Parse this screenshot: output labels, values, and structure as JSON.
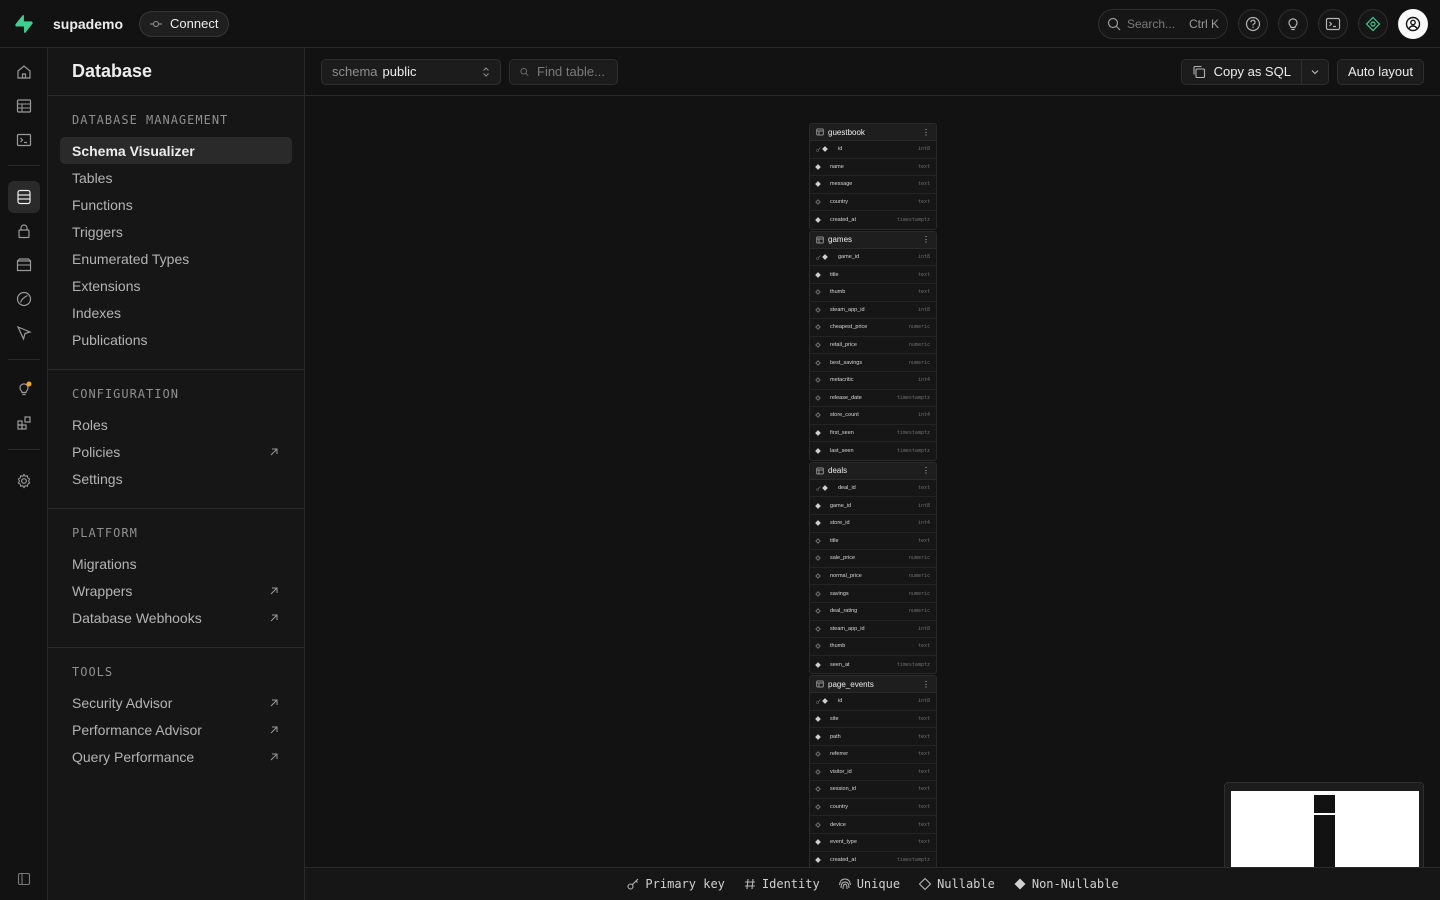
{
  "project": {
    "name": "supademo",
    "connect_label": "Connect"
  },
  "search": {
    "placeholder": "Search...",
    "shortcut": "Ctrl K"
  },
  "sidebar": {
    "title": "Database",
    "sections": [
      {
        "title": "DATABASE MANAGEMENT",
        "items": [
          "Schema Visualizer",
          "Tables",
          "Functions",
          "Triggers",
          "Enumerated Types",
          "Extensions",
          "Indexes",
          "Publications"
        ]
      },
      {
        "title": "CONFIGURATION",
        "items": [
          "Roles",
          "Policies",
          "Settings"
        ]
      },
      {
        "title": "PLATFORM",
        "items": [
          "Migrations",
          "Wrappers",
          "Database Webhooks"
        ]
      },
      {
        "title": "TOOLS",
        "items": [
          "Security Advisor",
          "Performance Advisor",
          "Query Performance"
        ]
      }
    ]
  },
  "toolbar": {
    "schema_label": "schema",
    "schema_value": "public",
    "find_placeholder": "Find table...",
    "copy_sql_label": "Copy as SQL",
    "auto_layout_label": "Auto layout"
  },
  "tables": [
    {
      "name": "guestbook",
      "columns": [
        {
          "name": "id",
          "type": "int8",
          "pk": true
        },
        {
          "name": "name",
          "type": "text",
          "nullable": false
        },
        {
          "name": "message",
          "type": "text",
          "nullable": false
        },
        {
          "name": "country",
          "type": "text",
          "nullable": true
        },
        {
          "name": "created_at",
          "type": "timestamptz",
          "nullable": false
        }
      ]
    },
    {
      "name": "games",
      "columns": [
        {
          "name": "game_id",
          "type": "int8",
          "pk": true
        },
        {
          "name": "title",
          "type": "text",
          "nullable": false
        },
        {
          "name": "thumb",
          "type": "text",
          "nullable": true
        },
        {
          "name": "steam_app_id",
          "type": "int8",
          "nullable": true
        },
        {
          "name": "cheapest_price",
          "type": "numeric",
          "nullable": true
        },
        {
          "name": "retail_price",
          "type": "numeric",
          "nullable": true
        },
        {
          "name": "best_savings",
          "type": "numeric",
          "nullable": true
        },
        {
          "name": "metacritic",
          "type": "int4",
          "nullable": true
        },
        {
          "name": "release_date",
          "type": "timestamptz",
          "nullable": true
        },
        {
          "name": "store_count",
          "type": "int4",
          "nullable": true
        },
        {
          "name": "first_seen",
          "type": "timestamptz",
          "nullable": false
        },
        {
          "name": "last_seen",
          "type": "timestamptz",
          "nullable": false
        }
      ]
    },
    {
      "name": "deals",
      "columns": [
        {
          "name": "deal_id",
          "type": "text",
          "pk": true
        },
        {
          "name": "game_id",
          "type": "int8",
          "nullable": false
        },
        {
          "name": "store_id",
          "type": "int4",
          "nullable": false
        },
        {
          "name": "title",
          "type": "text",
          "nullable": true
        },
        {
          "name": "sale_price",
          "type": "numeric",
          "nullable": true
        },
        {
          "name": "normal_price",
          "type": "numeric",
          "nullable": true
        },
        {
          "name": "savings",
          "type": "numeric",
          "nullable": true
        },
        {
          "name": "deal_rating",
          "type": "numeric",
          "nullable": true
        },
        {
          "name": "steam_app_id",
          "type": "int8",
          "nullable": true
        },
        {
          "name": "thumb",
          "type": "text",
          "nullable": true
        },
        {
          "name": "seen_at",
          "type": "timestamptz",
          "nullable": false
        }
      ]
    },
    {
      "name": "page_events",
      "columns": [
        {
          "name": "id",
          "type": "int8",
          "pk": true
        },
        {
          "name": "site",
          "type": "text",
          "nullable": false
        },
        {
          "name": "path",
          "type": "text",
          "nullable": false
        },
        {
          "name": "referrer",
          "type": "text",
          "nullable": true
        },
        {
          "name": "visitor_id",
          "type": "text",
          "nullable": true
        },
        {
          "name": "session_id",
          "type": "text",
          "nullable": true
        },
        {
          "name": "country",
          "type": "text",
          "nullable": true
        },
        {
          "name": "device",
          "type": "text",
          "nullable": true
        },
        {
          "name": "event_type",
          "type": "text",
          "nullable": false
        },
        {
          "name": "created_at",
          "type": "timestamptz",
          "nullable": false
        }
      ]
    }
  ],
  "legend": {
    "primary_key": "Primary key",
    "identity": "Identity",
    "unique": "Unique",
    "nullable": "Nullable",
    "non_nullable": "Non-Nullable"
  },
  "colors": {
    "brand": "#3ecf8e",
    "notification": "#f5a524"
  }
}
